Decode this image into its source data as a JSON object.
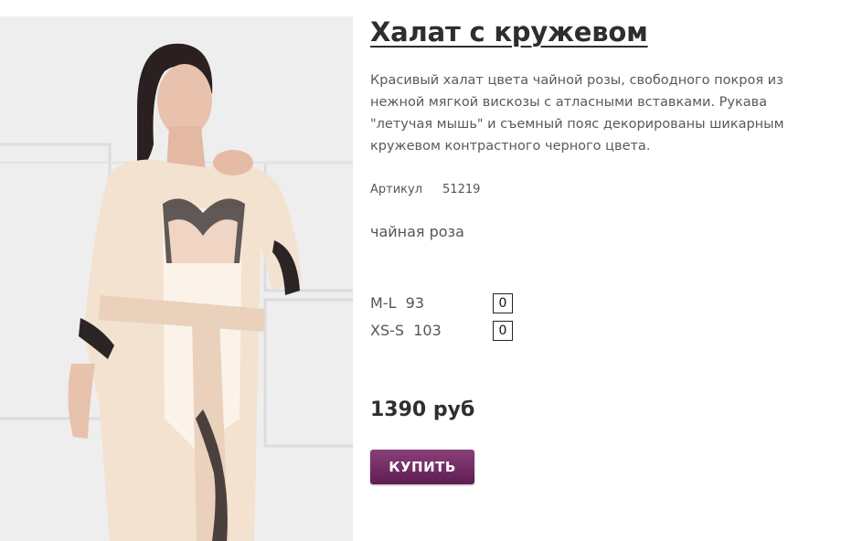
{
  "product": {
    "title": "Халат с кружевом",
    "description": "Красивый халат цвета чайной розы, свободного покроя из нежной мягкой вискозы с атласными вставками. Рукава \"летучая мышь\" и съемный пояс декорированы шикарным кружевом контрастного черного цвета.",
    "sku_label": "Артикул",
    "sku_value": "51219",
    "color": "чайная роза",
    "sizes": [
      {
        "label": "M-L  93",
        "qty": "0"
      },
      {
        "label": "XS-S  103",
        "qty": "0"
      }
    ],
    "price": "1390 руб",
    "buy_label": "КУПИТЬ"
  },
  "colors": {
    "button": "#6f2c63",
    "title": "#2e2e2e"
  }
}
